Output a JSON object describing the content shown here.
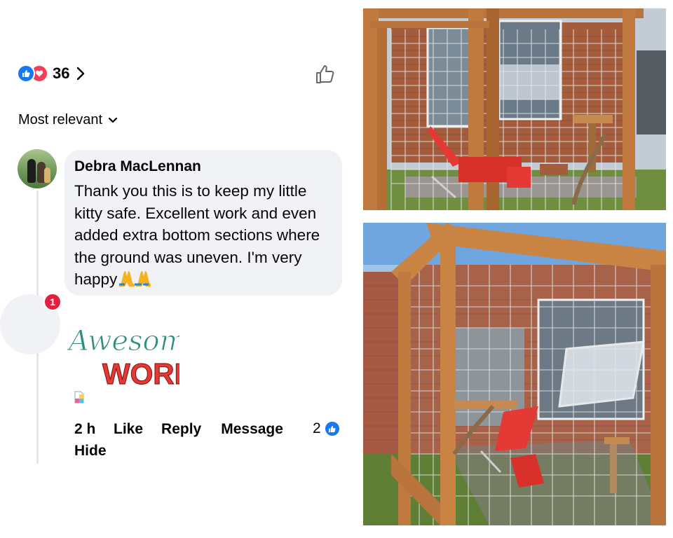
{
  "reactions": {
    "count": "36"
  },
  "sort": {
    "label": "Most relevant"
  },
  "comment": {
    "author": "Debra MacLennan",
    "text": "Thank you this is to keep my little kitty safe. Excellent work and even added extra bottom sections where the ground was uneven. I'm very happy",
    "notification_badge": "1",
    "sticker_text": [
      "Awesome",
      "WORK"
    ],
    "actions": {
      "time_ago": "2 h",
      "like_label": "Like",
      "reply_label": "Reply",
      "message_label": "Message",
      "hide_label": "Hide",
      "like_count": "2"
    }
  },
  "colors": {
    "like_blue": "#1877f2",
    "love_red": "#f33e58",
    "bubble_bg": "#f0f2f5",
    "sticker_green": "#2f8f7f",
    "sticker_red": "#e53935"
  },
  "icons": [
    "like-reaction-icon",
    "love-reaction-icon",
    "chevron-right-icon",
    "thumbs-up-outline-icon",
    "chevron-down-icon",
    "folded-hands-emoji",
    "media-file-icon"
  ]
}
